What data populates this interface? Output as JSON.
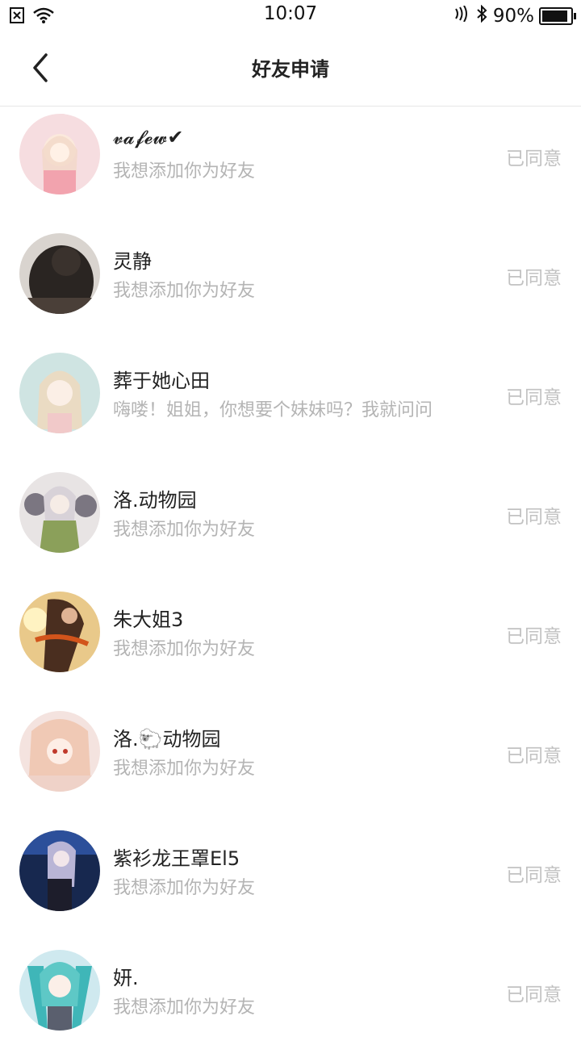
{
  "status_bar": {
    "time": "10:07",
    "battery_text": "90%",
    "battery_level": 0.9
  },
  "header": {
    "title": "好友申请"
  },
  "requests": [
    {
      "name": "𝓿𝓪𝓯𝓮𝔀✔",
      "message": "我想添加你为好友",
      "status": "已同意"
    },
    {
      "name": "灵静",
      "message": "我想添加你为好友",
      "status": "已同意"
    },
    {
      "name": "葬于她心田",
      "message": "嗨喽！姐姐，你想要个妹妹吗？我就问问",
      "status": "已同意"
    },
    {
      "name": "洛.动物园",
      "message": "我想添加你为好友",
      "status": "已同意"
    },
    {
      "name": "朱大姐3",
      "message": "我想添加你为好友",
      "status": "已同意"
    },
    {
      "name": "洛.🐑动物园",
      "message": "我想添加你为好友",
      "status": "已同意"
    },
    {
      "name": "紫衫龙王罩El5",
      "message": "我想添加你为好友",
      "status": "已同意"
    },
    {
      "name": "妍.",
      "message": "我想添加你为好友",
      "status": "已同意"
    }
  ]
}
